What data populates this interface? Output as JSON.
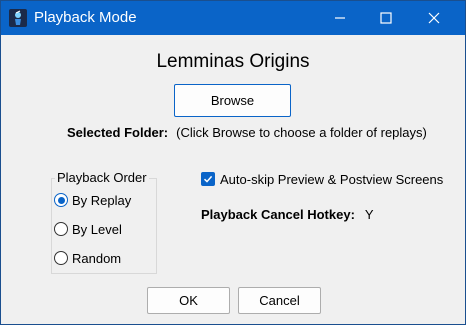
{
  "window": {
    "title": "Playback Mode",
    "controls": {
      "minimize_icon": "minimize-icon",
      "maximize_icon": "maximize-icon",
      "close_icon": "close-icon"
    },
    "accent_color": "#0a64c8"
  },
  "main": {
    "game_title": "Lemminas Origins",
    "browse_label": "Browse",
    "selected_folder_label": "Selected Folder:",
    "selected_folder_value": "(Click Browse to choose a folder of replays)"
  },
  "playback_order": {
    "title": "Playback Order",
    "options": [
      {
        "label": "By Replay",
        "checked": true
      },
      {
        "label": "By Level",
        "checked": false
      },
      {
        "label": "Random",
        "checked": false
      }
    ]
  },
  "options": {
    "auto_skip_label": "Auto-skip Preview & Postview Screens",
    "auto_skip_checked": true,
    "hotkey_label": "Playback Cancel Hotkey:",
    "hotkey_value": "Y"
  },
  "footer": {
    "ok_label": "OK",
    "cancel_label": "Cancel"
  }
}
